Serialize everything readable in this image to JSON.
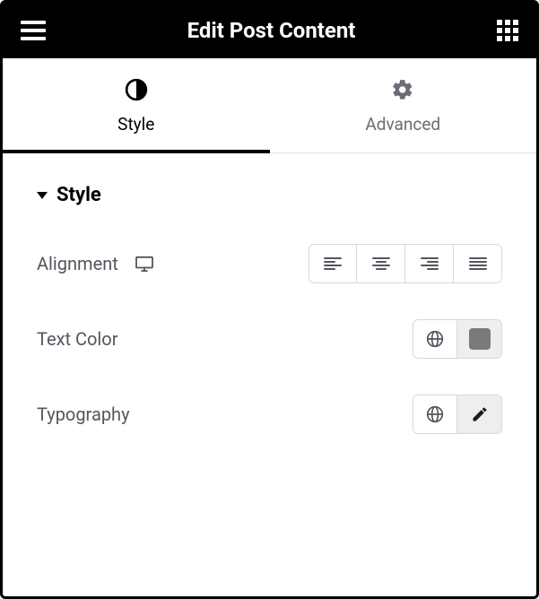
{
  "header": {
    "title": "Edit Post Content"
  },
  "tabs": {
    "style": "Style",
    "advanced": "Advanced"
  },
  "section": {
    "title": "Style"
  },
  "rows": {
    "alignment": "Alignment",
    "textcolor": "Text Color",
    "typography": "Typography"
  },
  "swatch_color": "#7a7a7a"
}
